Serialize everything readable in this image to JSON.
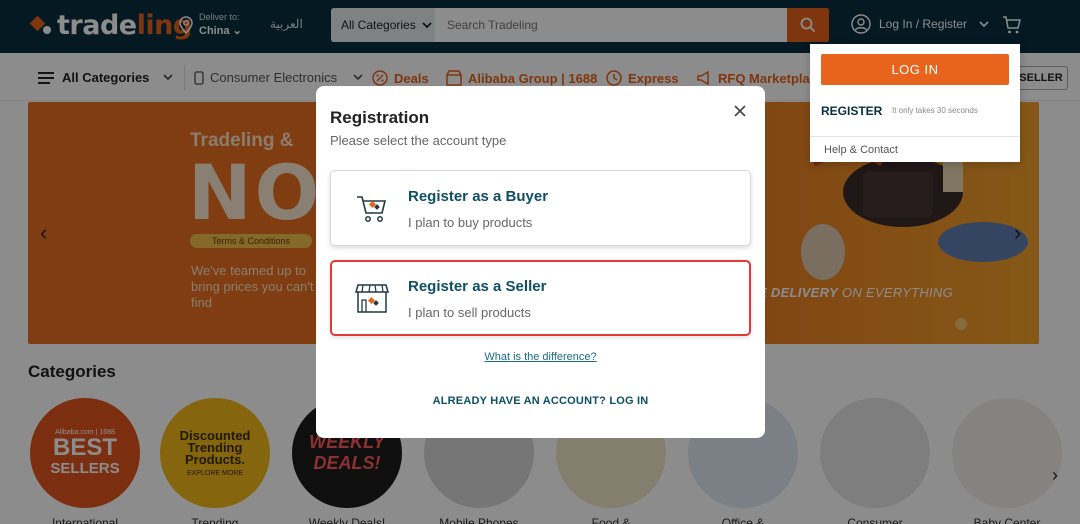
{
  "header": {
    "logo_main": "trade",
    "logo_accent": "ling",
    "deliver_label": "Deliver to:",
    "deliver_country": "China",
    "language": "العربية",
    "search_category": "All Categories",
    "search_placeholder": "Search Tradeling",
    "login_label": "Log In / Register"
  },
  "nav": {
    "all_categories": "All Categories",
    "items": [
      "Consumer Electronics",
      "Deals",
      "Alibaba Group | 1688",
      "Express",
      "RFQ Marketplace"
    ],
    "seller_tag": "SELLER"
  },
  "banner": {
    "heading": "Tradeling &",
    "big_text": "NOW",
    "terms": "Terms & Conditions",
    "copy": "We've teamed up to bring prices you can't find",
    "delivery_bold": "E DELIVERY",
    "delivery_rest": " ON EVERYTHING"
  },
  "categories": {
    "title": "Categories",
    "items": [
      {
        "label": "International",
        "art_line1": "Alibaba.com | 1688",
        "art_line2": "BEST",
        "art_line3": "SELLERS",
        "bg": "#e2571e"
      },
      {
        "label": "Trending",
        "art_line1": "Discounted",
        "art_line2": "Trending",
        "art_line3": "Products.",
        "art_line4": "EXPLORE MORE",
        "bg": "#f2b81b"
      },
      {
        "label": "Weekly Deals!",
        "art_line1": "WEEKLY",
        "art_line2": "DEALS!",
        "bg": "#1d1d1d"
      },
      {
        "label": "Mobile Phones",
        "bg": "#d7d7d7"
      },
      {
        "label": "Food &",
        "bg": "#f1e6c9"
      },
      {
        "label": "Office &",
        "bg": "#dfe9f2"
      },
      {
        "label": "Consumer",
        "bg": "#e6e6e6"
      },
      {
        "label": "Baby Center",
        "bg": "#f0eeea"
      }
    ]
  },
  "dropdown": {
    "login_button": "LOG IN",
    "register_label": "REGISTER",
    "register_note": "It only takes 30 seconds",
    "help_link": "Help & Contact"
  },
  "modal": {
    "title": "Registration",
    "subtitle": "Please select the account type",
    "buyer": {
      "title": "Register as a Buyer",
      "desc": "I plan to buy products"
    },
    "seller": {
      "title": "Register as a Seller",
      "desc": "I plan to sell products"
    },
    "difference_link": "What is the difference?",
    "already_link": "ALREADY HAVE AN ACCOUNT? LOG IN"
  },
  "colors": {
    "header_bg": "#082f3f",
    "brand_orange": "#e8631b",
    "option_title": "#0e4f63",
    "selected_border": "#e03a32"
  }
}
